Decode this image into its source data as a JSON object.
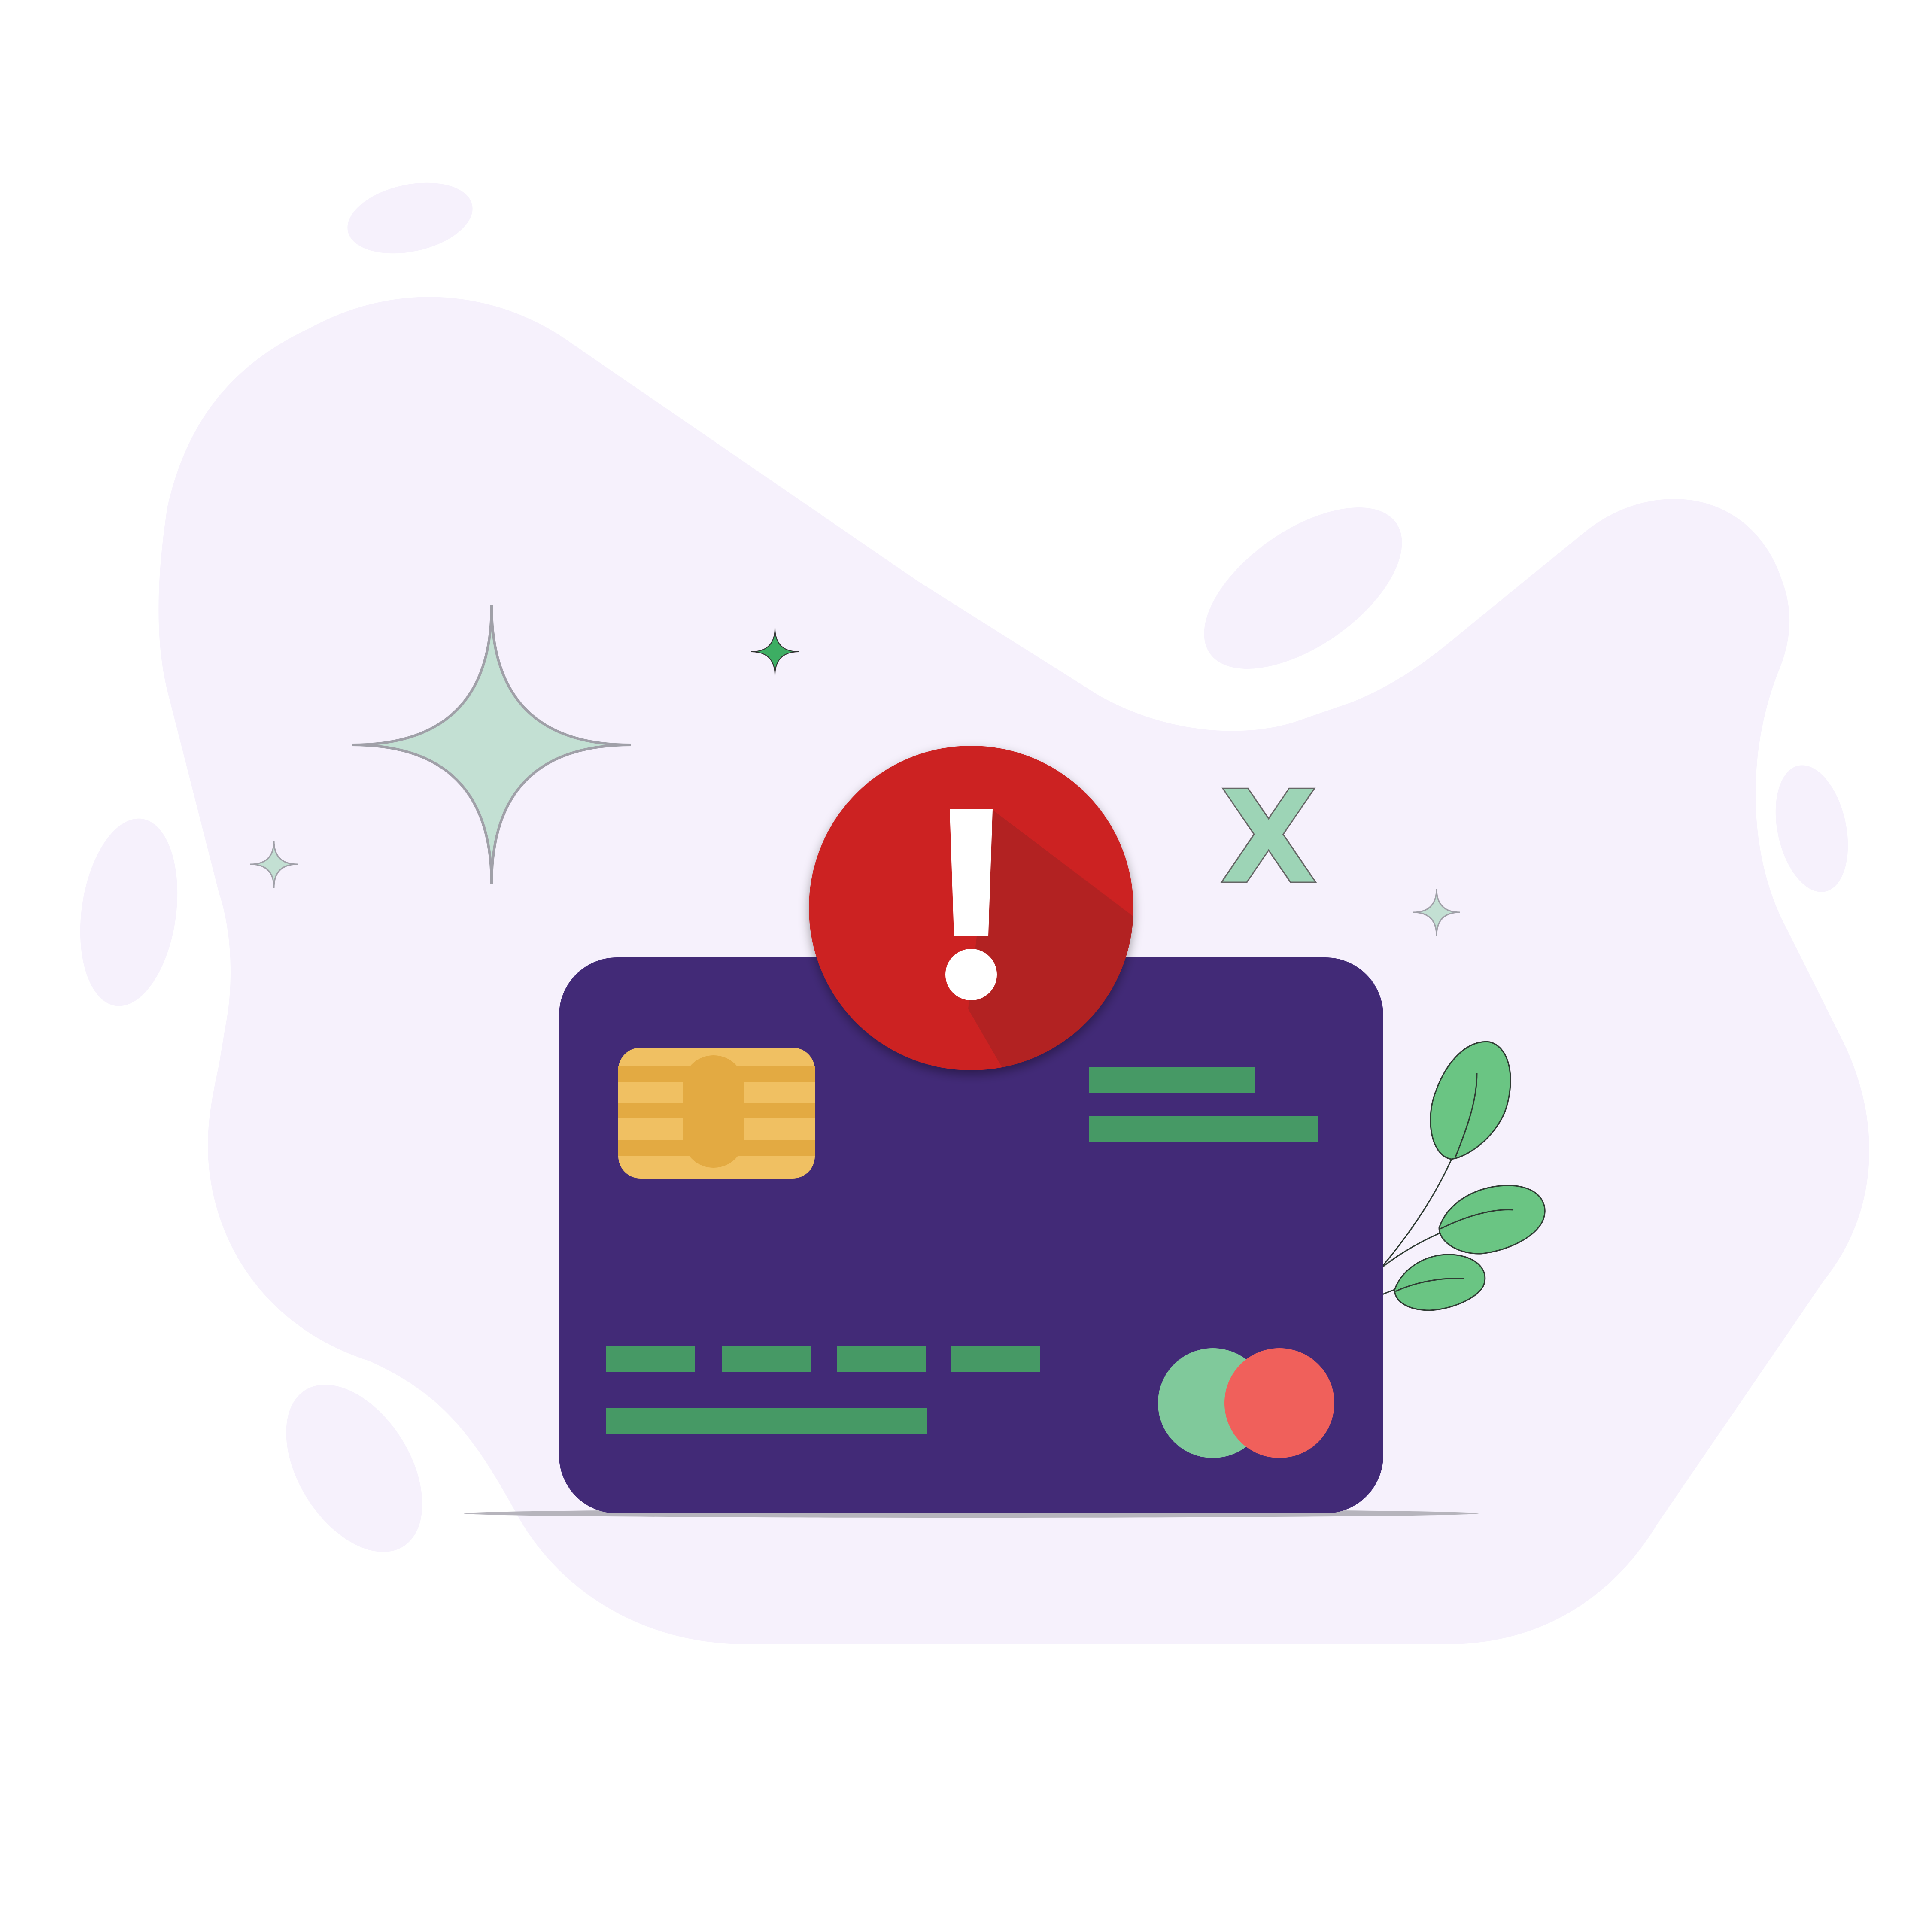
{
  "scene": {
    "background_color": "#ffffff",
    "blob_color": "#f6f1fc",
    "sparkle_color": "#c3e0d3",
    "sparkle_accent_color": "#3dae63"
  },
  "alert_badge": {
    "symbol": "!",
    "icon": "exclamation-icon",
    "color": "#cc2424",
    "shadow_color": "#b22222"
  },
  "credit_card": {
    "body_color": "#422a77",
    "chip_color": "#f0c062",
    "chip_contact_color": "#e3aa42",
    "stripe_color": "#469965",
    "brand_logo": {
      "icon": "card-brand-logo",
      "left_circle_color": "#80c99b",
      "right_circle_color": "#f0605b"
    }
  },
  "decline_mark": {
    "symbol": "X",
    "color": "#9dd4b6"
  },
  "plant": {
    "leaf_color": "#6ac583"
  }
}
